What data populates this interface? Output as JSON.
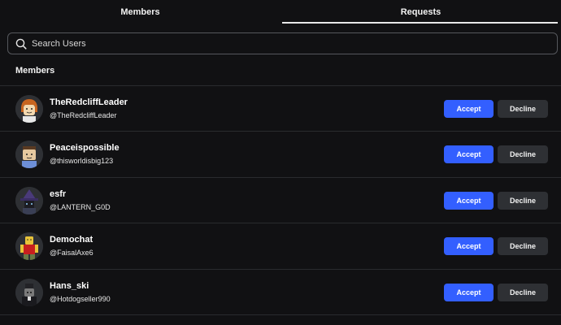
{
  "tabs": [
    {
      "label": "Members",
      "active": false
    },
    {
      "label": "Requests",
      "active": true
    }
  ],
  "search": {
    "placeholder": "Search Users",
    "value": "",
    "icon": "search-icon"
  },
  "section_title": "Members",
  "colors": {
    "background": "#111113",
    "accept": "#335fff",
    "decline": "#2e3034",
    "divider": "#2a2b2e"
  },
  "requests": [
    {
      "display_name": "TheRedcliffLeader",
      "username": "@TheRedcliffLeader",
      "accept_label": "Accept",
      "decline_label": "Decline"
    },
    {
      "display_name": "Peaceispossible",
      "username": "@thisworldisbig123",
      "accept_label": "Accept",
      "decline_label": "Decline"
    },
    {
      "display_name": "esfr",
      "username": "@LANTERN_G0D",
      "accept_label": "Accept",
      "decline_label": "Decline"
    },
    {
      "display_name": "Demochat",
      "username": "@FaisalAxe6",
      "accept_label": "Accept",
      "decline_label": "Decline"
    },
    {
      "display_name": "Hans_ski",
      "username": "@Hotdogseller990",
      "accept_label": "Accept",
      "decline_label": "Decline"
    }
  ]
}
